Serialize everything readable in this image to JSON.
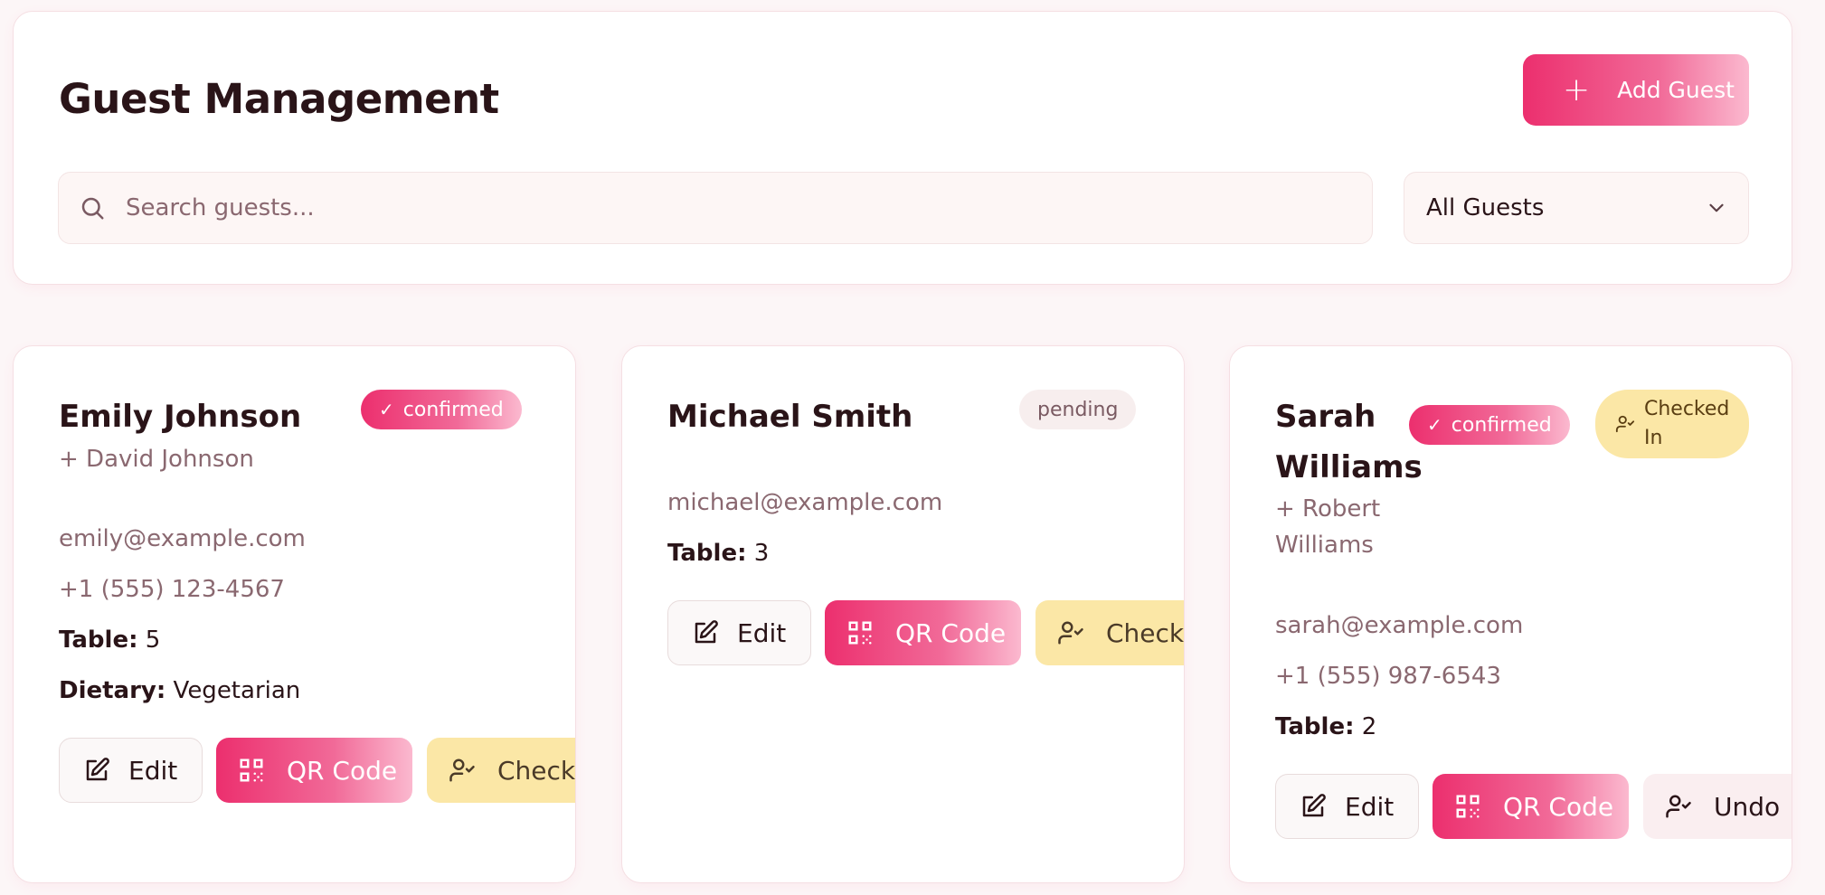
{
  "header": {
    "title": "Guest Management",
    "add_button": "Add Guest",
    "search_placeholder": "Search guests...",
    "filter_selected": "All Guests"
  },
  "labels": {
    "table": "Table:",
    "dietary": "Dietary:",
    "edit": "Edit",
    "qr": "QR Code",
    "check": "Check",
    "undo": "Undo"
  },
  "guests": [
    {
      "name": "Emily Johnson",
      "plus_one": "+ David Johnson",
      "status": "confirmed",
      "email": "emily@example.com",
      "phone": "+1 (555) 123-4567",
      "table": "5",
      "dietary": "Vegetarian"
    },
    {
      "name": "Michael Smith",
      "status": "pending",
      "email": "michael@example.com",
      "table": "3"
    },
    {
      "name_line1": "Sarah",
      "name_line2": "Williams",
      "plus_one_line1": "+ Robert",
      "plus_one_line2": "Williams",
      "status": "confirmed",
      "checked_in_line1": "Checked",
      "checked_in_line2": "In",
      "email": "sarah@example.com",
      "phone": "+1 (555) 987-6543",
      "table": "2"
    }
  ],
  "colors": {
    "accent": "#ec2f6e",
    "check_bg": "#fbe7a6",
    "pending_bg": "#f7eeee",
    "text_muted": "#8a6870"
  },
  "icons": [
    "search-icon",
    "plus-icon",
    "chevron-down-icon",
    "check-icon",
    "user-check-icon",
    "edit-icon",
    "qr-code-icon"
  ]
}
